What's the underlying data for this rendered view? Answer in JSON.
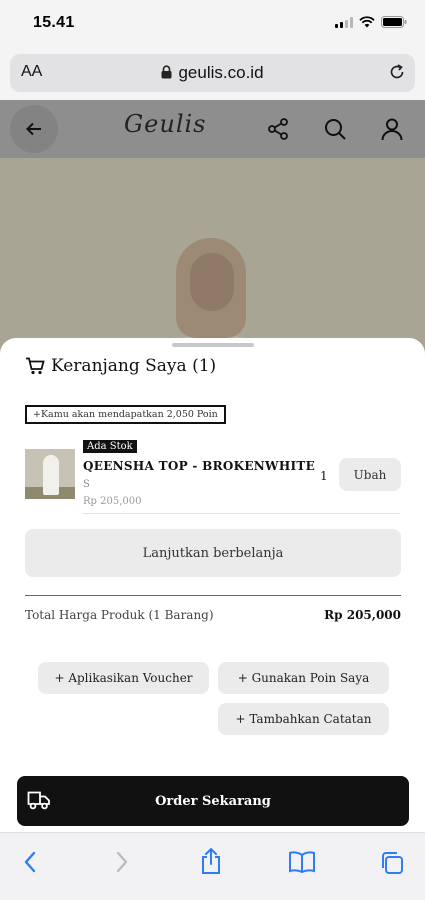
{
  "status_bar": {
    "time": "15.41"
  },
  "browser": {
    "aa_label": "AA",
    "url": "geulis.co.id"
  },
  "site": {
    "logo": "Geulis"
  },
  "cart": {
    "title": "Keranjang Saya (1)",
    "points_notice": "+Kamu akan mendapatkan 2,050 Poin",
    "items": [
      {
        "stock_badge": "Ada Stok",
        "name": "QEENSHA TOP - BROKENWHITE",
        "size": "S",
        "price": "Rp 205,000",
        "quantity": "1",
        "edit_label": "Ubah"
      }
    ],
    "continue_label": "Lanjutkan berbelanja",
    "total_label": "Total Harga Produk (1 Barang)",
    "total_value": "Rp 205,000",
    "actions": {
      "voucher": "+ Aplikasikan Voucher",
      "points": "+ Gunakan Poin Saya",
      "note": "+ Tambahkan Catatan"
    },
    "order_label": "Order Sekarang"
  },
  "icons": {
    "cart": "cart-icon",
    "truck": "truck-icon",
    "share": "share-icon",
    "search": "search-icon",
    "account": "user-icon",
    "back": "arrow-left-icon"
  },
  "colors": {
    "primary": "#111111",
    "button_bg": "#ebebeb",
    "safari_blue": "#2f7df6"
  }
}
